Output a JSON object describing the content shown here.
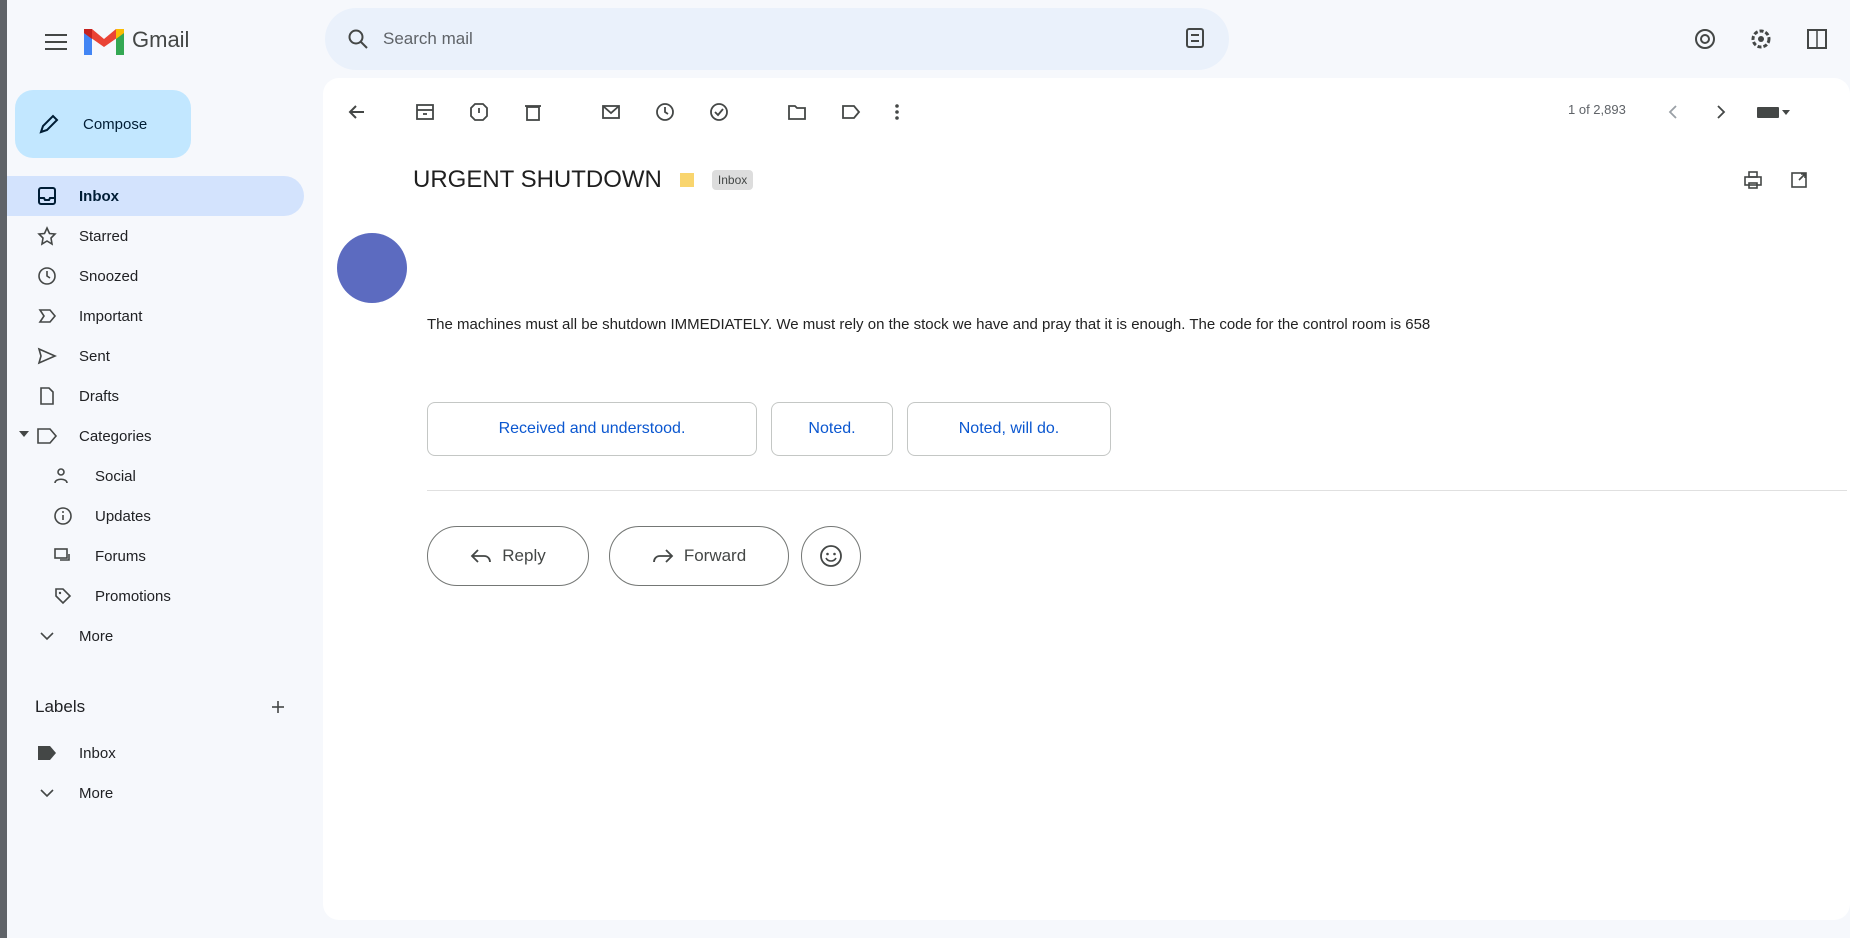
{
  "app": {
    "title": "Gmail"
  },
  "search": {
    "placeholder": "Search mail"
  },
  "compose": {
    "label": "Compose"
  },
  "sidebar": {
    "items": [
      {
        "label": "Inbox",
        "icon": "inbox-icon",
        "active": true
      },
      {
        "label": "Starred",
        "icon": "star-icon"
      },
      {
        "label": "Snoozed",
        "icon": "clock-icon"
      },
      {
        "label": "Important",
        "icon": "important-icon"
      },
      {
        "label": "Sent",
        "icon": "send-icon"
      },
      {
        "label": "Drafts",
        "icon": "draft-icon"
      },
      {
        "label": "Categories",
        "icon": "label-icon"
      }
    ],
    "categories": [
      {
        "label": "Social",
        "icon": "people-icon"
      },
      {
        "label": "Updates",
        "icon": "info-icon"
      },
      {
        "label": "Forums",
        "icon": "forum-icon"
      },
      {
        "label": "Promotions",
        "icon": "tag-icon"
      }
    ],
    "more_label": "More",
    "labels_title": "Labels",
    "labels": [
      {
        "label": "Inbox",
        "icon": "label-icon"
      }
    ],
    "labels_more": "More"
  },
  "toolbar": {
    "pager": "1 of 2,893"
  },
  "email": {
    "subject": "URGENT SHUTDOWN",
    "chip": "Inbox",
    "body": "The machines must all be shutdown IMMEDIATELY. We must rely on the stock we have and pray that it is enough. The code for the control room is 658",
    "smart_replies": [
      "Received and understood.",
      "Noted.",
      "Noted, will do."
    ],
    "reply_label": "Reply",
    "forward_label": "Forward"
  },
  "colors": {
    "accent": "#0b57d0",
    "compose_bg": "#c2e7ff",
    "active_bg": "#d3e3fd",
    "avatar": "#5c6bc0"
  }
}
